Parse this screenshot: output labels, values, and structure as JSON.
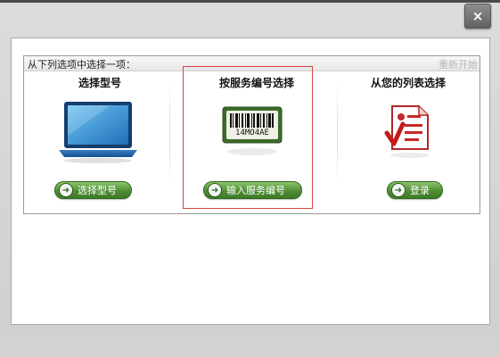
{
  "dialog": {
    "close_label": "×",
    "prompt": "从下列选项中选择一项：",
    "restart_label": "重新开始",
    "options": [
      {
        "title": "选择型号",
        "button_label": "选择型号"
      },
      {
        "title": "按服务编号选择",
        "button_label": "输入服务编号",
        "barcode_text": "14MO4AE"
      },
      {
        "title": "从您的列表选择",
        "button_label": "登录"
      }
    ],
    "colors": {
      "highlight": "#d9423e",
      "button_green": "#4f8d34"
    }
  }
}
